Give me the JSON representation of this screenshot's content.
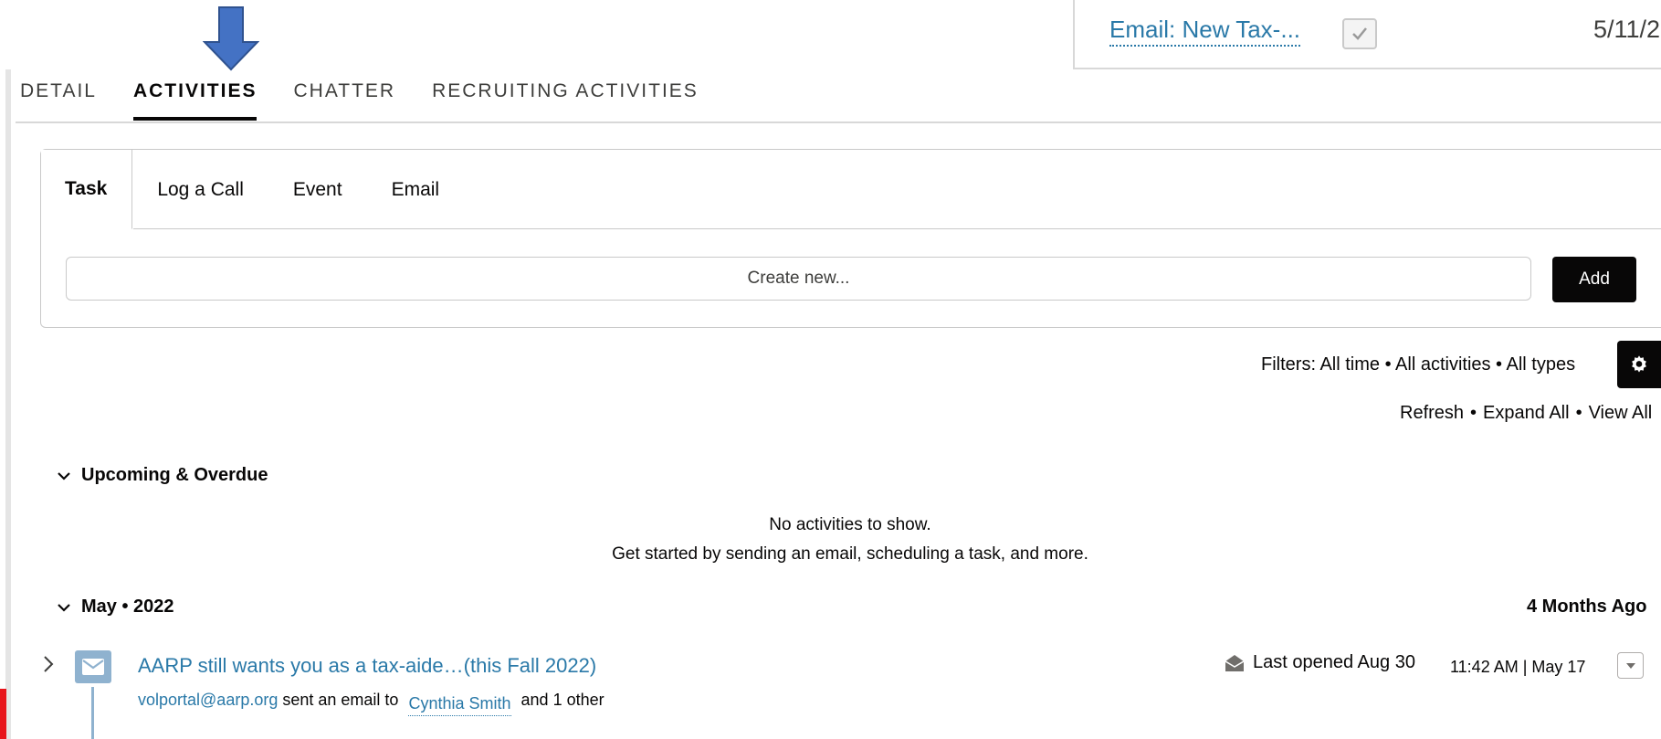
{
  "top_record": {
    "link_label": "Email: New Tax-...",
    "date": "5/11/2",
    "checked": true
  },
  "tabs": [
    {
      "label": "DETAIL"
    },
    {
      "label": "ACTIVITIES",
      "active": true
    },
    {
      "label": "CHATTER"
    },
    {
      "label": "RECRUITING ACTIVITIES"
    }
  ],
  "composer": {
    "tabs": [
      {
        "label": "Task",
        "active": true
      },
      {
        "label": "Log a Call"
      },
      {
        "label": "Event"
      },
      {
        "label": "Email"
      }
    ],
    "input_placeholder": "Create new...",
    "add_label": "Add"
  },
  "filters": {
    "text": "Filters: All time • All activities • All types",
    "icon": "gear-icon"
  },
  "actions": {
    "refresh": "Refresh",
    "expand_all": "Expand All",
    "view_all": "View All",
    "separator": "•"
  },
  "upcoming": {
    "title": "Upcoming & Overdue",
    "empty_line1": "No activities to show.",
    "empty_line2": "Get started by sending an email, scheduling a task, and more."
  },
  "month_group": {
    "title": "May • 2022",
    "relative": "4 Months Ago",
    "items": [
      {
        "title": "AARP still wants you as a tax-aide…(this Fall 2022)",
        "from": "volportal@aarp.org",
        "sent_text": "sent an email to",
        "to": "Cynthia Smith",
        "others": "and 1 other",
        "opened": "Last opened Aug 30",
        "time": "11:42 AM | May 17"
      }
    ]
  },
  "colors": {
    "link": "#2a79a8",
    "email_icon": "#8fb2cf",
    "pointer_arrow": "#4472c4",
    "accent_red": "#e8141b",
    "button_dark": "#080707"
  }
}
